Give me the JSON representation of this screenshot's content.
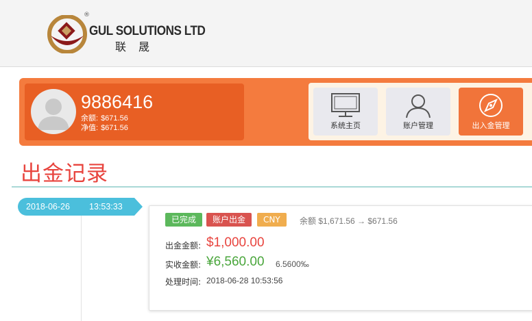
{
  "brand": {
    "name": "GUL SOLUTIONS LTD",
    "name_cn": "联晟",
    "registered_mark": "®"
  },
  "user": {
    "id": "9886416",
    "balance_label": "余额:",
    "balance_value": "$671.56",
    "equity_label": "净值:",
    "equity_value": "$671.56"
  },
  "menu": [
    {
      "label": "系统主页",
      "icon": "monitor-icon",
      "active": false
    },
    {
      "label": "账户管理",
      "icon": "user-icon",
      "active": false
    },
    {
      "label": "出入金管理",
      "icon": "compass-icon",
      "active": true
    }
  ],
  "page_title": "出金记录",
  "record": {
    "date": "2018-06-26",
    "time": "13:53:33",
    "status": "已完成",
    "type": "账户出金",
    "currency": "CNY",
    "balance_change": "余额 $1,671.56 → $671.56",
    "withdraw_label": "出金金额:",
    "withdraw_amount": "$1,000.00",
    "received_label": "实收金额:",
    "received_amount": "¥6,560.00",
    "rate": "6.5600‰",
    "processed_label": "处理时间:",
    "processed_time": "2018-06-28 10:53:56"
  },
  "colors": {
    "accent_orange": "#f47b3e",
    "title_red": "#e8443e",
    "timeline_blue": "#4bbfdc",
    "success_green": "#5cb85c"
  }
}
